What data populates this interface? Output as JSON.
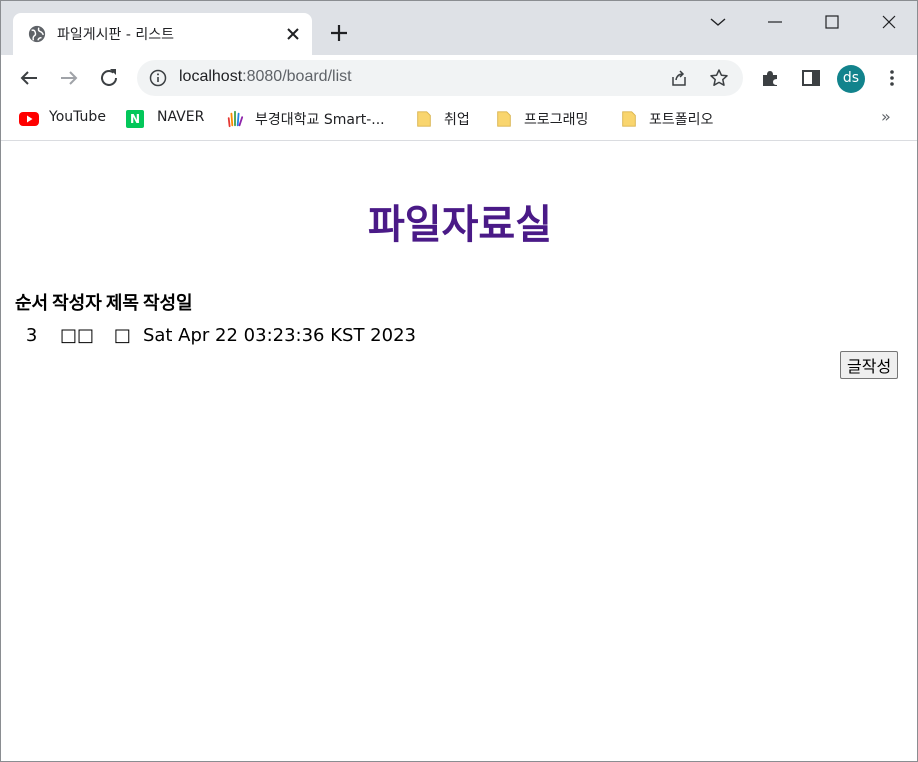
{
  "browser": {
    "tab_title": "파일게시판 - 리스트",
    "url_host": "localhost",
    "url_path": ":8080/board/list",
    "avatar_initials": "ds",
    "avatar_color": "#12838c"
  },
  "bookmarks": [
    {
      "label": "YouTube",
      "icon": "youtube-icon"
    },
    {
      "label": "NAVER",
      "icon": "naver-icon",
      "icon_text": "N"
    },
    {
      "label": "부경대학교 Smart-...",
      "icon": "pknu-hand-icon"
    },
    {
      "label": "취업",
      "icon": "folder-icon"
    },
    {
      "label": "프로그래밍",
      "icon": "folder-icon"
    },
    {
      "label": "포트폴리오",
      "icon": "folder-icon"
    }
  ],
  "bookmarks_more": "»",
  "page": {
    "title": "파일자료실",
    "title_color": "#4a1a87",
    "columns": [
      "순서",
      "작성자",
      "제목",
      "작성일"
    ],
    "rows": [
      {
        "seq": "3",
        "writer": "□□",
        "subject": "□",
        "date": "Sat Apr 22 03:23:36 KST 2023"
      }
    ],
    "write_button": "글작성"
  }
}
